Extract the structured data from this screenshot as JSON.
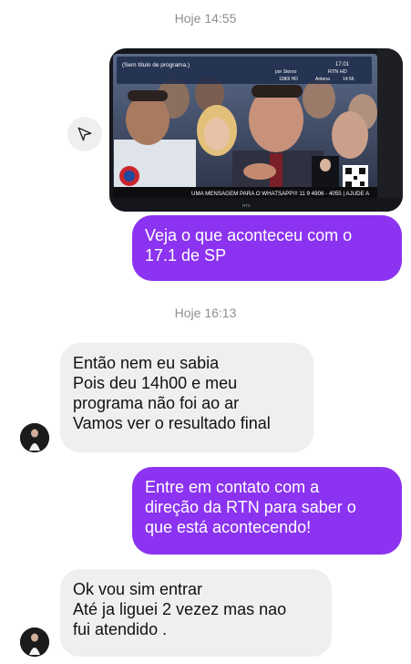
{
  "conversation": {
    "timestamp_1": "Hoje 14:55",
    "timestamp_2": "Hoje 16:13",
    "media": {
      "tv_program_label": "(Sem título de programa.)",
      "tv_channel_number": "17.01",
      "tv_channel_name": "RTN HD",
      "tv_info_left": "por Storoo",
      "tv_quality": "1080i HD",
      "tv_source": "Antena",
      "tv_clock": "14:56",
      "tv_ticker": "UMA MENSAGEM PARA O WHATSAPP!!! 11 9 4906 - 4055 | AJUDE A",
      "tv_brand": "RTC"
    },
    "messages": [
      {
        "sender": "me",
        "text": "Veja o que aconteceu com o\n17.1 de SP"
      },
      {
        "sender": "contact",
        "text": "Então nem eu sabia\nPois deu 14h00 e meu\nprograma não foi ao ar\nVamos ver o resultado final"
      },
      {
        "sender": "me",
        "text": "Entre em contato com a\ndireção da RTN para saber o\nque está acontecendo!"
      },
      {
        "sender": "contact",
        "text": "Ok vou sim entrar\nAté ja liguei 2 vezez mas nao\nfui atendido ."
      }
    ]
  },
  "icons": {
    "share": "send-share-icon",
    "avatar": "contact-avatar"
  },
  "colors": {
    "outgoing_bubble": "#8b33f0",
    "incoming_bubble": "#efefef",
    "timestamp": "#8e8e93",
    "background": "#ffffff"
  }
}
